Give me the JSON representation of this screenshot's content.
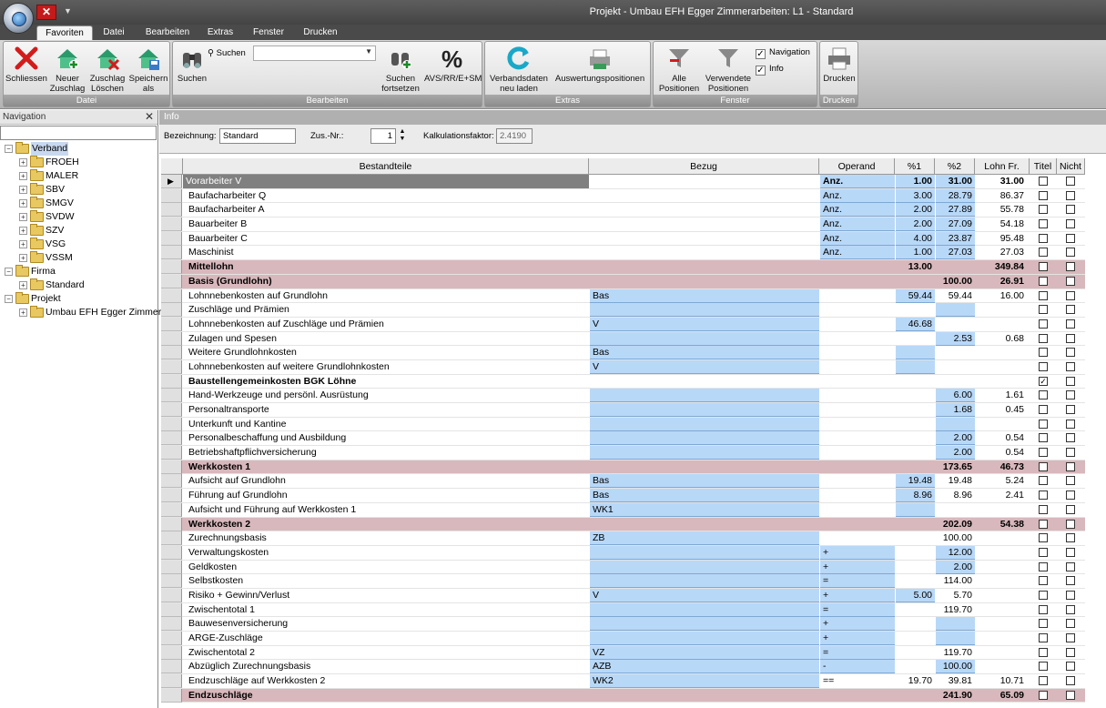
{
  "window": {
    "title": "Projekt - Umbau EFH Egger Zimmerarbeiten: L1 - Standard"
  },
  "qat": {
    "close_glyph": "✕",
    "dropdown_glyph": "▼"
  },
  "tabs": [
    {
      "label": "Favoriten",
      "active": true
    },
    {
      "label": "Datei"
    },
    {
      "label": "Bearbeiten"
    },
    {
      "label": "Extras"
    },
    {
      "label": "Fenster"
    },
    {
      "label": "Drucken"
    }
  ],
  "ribbon": {
    "datei": {
      "label": "Datei",
      "schliessen": "Schliessen",
      "neuer_zuschlag_1": "Neuer",
      "neuer_zuschlag_2": "Zuschlag",
      "zuschlag_loeschen_1": "Zuschlag",
      "zuschlag_loeschen_2": "Löschen",
      "speichern_als_1": "Speichern",
      "speichern_als_2": "als"
    },
    "bearbeiten": {
      "label": "Bearbeiten",
      "suchen": "Suchen",
      "suchen_label": "Suchen",
      "suchen_fortsetzen_1": "Suchen",
      "suchen_fortsetzen_2": "fortsetzen",
      "avs": "AVS/RR/E+SM"
    },
    "extras": {
      "label": "Extras",
      "verbandsdaten_1": "Verbandsdaten",
      "verbandsdaten_2": "neu laden",
      "auswertungspositionen": "Auswertungspositionen"
    },
    "fenster": {
      "label": "Fenster",
      "alle_1": "Alle",
      "alle_2": "Positionen",
      "verwendete_1": "Verwendete",
      "verwendete_2": "Positionen",
      "navigation": "Navigation",
      "info": "Info",
      "checkmark": "✓"
    },
    "drucken": {
      "label": "Drucken",
      "drucken": "Drucken"
    }
  },
  "navigation": {
    "title": "Navigation",
    "close": "✕",
    "expanded_glyph": "−",
    "collapsed_glyph": "+",
    "tree": [
      {
        "label": "Verband",
        "level": 0,
        "expanded": true,
        "selected": true
      },
      {
        "label": "FROEH",
        "level": 1
      },
      {
        "label": "MALER",
        "level": 1
      },
      {
        "label": "SBV",
        "level": 1
      },
      {
        "label": "SMGV",
        "level": 1
      },
      {
        "label": "SVDW",
        "level": 1
      },
      {
        "label": "SZV",
        "level": 1
      },
      {
        "label": "VSG",
        "level": 1
      },
      {
        "label": "VSSM",
        "level": 1
      },
      {
        "label": "Firma",
        "level": 0,
        "expanded": true
      },
      {
        "label": "Standard",
        "level": 1
      },
      {
        "label": "Projekt",
        "level": 0,
        "expanded": true
      },
      {
        "label": "Umbau EFH Egger Zimmerar",
        "level": 1
      }
    ]
  },
  "info": {
    "bar_label": "Info",
    "bezeichnung_label": "Bezeichnung:",
    "bezeichnung_value": "Standard",
    "zus_nr_label": "Zus.-Nr.:",
    "zus_nr_value": "1",
    "kalk_label": "Kalkulationsfaktor:",
    "kalk_value": "2.4190"
  },
  "grid": {
    "row_marker": "▶",
    "check_glyph": "✓",
    "columns": {
      "bestandteile": "Bestandteile",
      "bezug": "Bezug",
      "operand": "Operand",
      "p1": "%1",
      "p2": "%2",
      "lohn": "Lohn Fr.",
      "titel": "Titel",
      "nicht": "Nicht"
    },
    "rows": [
      {
        "name": "Vorarbeiter V",
        "name_dark": true,
        "bezug": "",
        "op": "Anz.",
        "op_blue": true,
        "op_bold": true,
        "p1": "1.00",
        "p1_blue": true,
        "p1_bold": true,
        "p2": "31.00",
        "p2_blue": true,
        "p2_bold": true,
        "lohn": "31.00",
        "lohn_bold": true,
        "titel": false,
        "current": true
      },
      {
        "name": "Baufacharbeiter Q",
        "op": "Anz.",
        "op_blue": true,
        "p1": "3.00",
        "p1_blue": true,
        "p2": "28.79",
        "p2_blue": true,
        "lohn": "86.37"
      },
      {
        "name": "Baufacharbeiter A",
        "op": "Anz.",
        "op_blue": true,
        "p1": "2.00",
        "p1_blue": true,
        "p2": "27.89",
        "p2_blue": true,
        "lohn": "55.78"
      },
      {
        "name": "Bauarbeiter B",
        "op": "Anz.",
        "op_blue": true,
        "p1": "2.00",
        "p1_blue": true,
        "p2": "27.09",
        "p2_blue": true,
        "lohn": "54.18"
      },
      {
        "name": "Bauarbeiter C",
        "op": "Anz.",
        "op_blue": true,
        "p1": "4.00",
        "p1_blue": true,
        "p2": "23.87",
        "p2_blue": true,
        "lohn": "95.48"
      },
      {
        "name": "Maschinist",
        "op": "Anz.",
        "op_blue": true,
        "p1": "1.00",
        "p1_blue": true,
        "p2": "27.03",
        "p2_blue": true,
        "lohn": "27.03"
      },
      {
        "name": "Mittellohn",
        "hl": true,
        "bold": true,
        "p1": "13.00",
        "lohn": "349.84"
      },
      {
        "name": "Basis (Grundlohn)",
        "hl": true,
        "bold": true,
        "p2": "100.00",
        "lohn": "26.91"
      },
      {
        "name": "Lohnnebenkosten auf Grundlohn",
        "bezug": "Bas",
        "bezug_blue": true,
        "p1": "59.44",
        "p1_blue": true,
        "p2": "59.44",
        "lohn": "16.00"
      },
      {
        "name": "Zuschläge und Prämien",
        "bezug": "",
        "bezug_blue": true,
        "p2": "",
        "p2_blue": true
      },
      {
        "name": "Lohnnebenkosten auf Zuschläge und Prämien",
        "bezug": "V",
        "bezug_blue": true,
        "p1": "46.68",
        "p1_blue": true
      },
      {
        "name": "Zulagen und Spesen",
        "bezug": "",
        "bezug_blue": true,
        "p2": "2.53",
        "p2_blue": true,
        "lohn": "0.68"
      },
      {
        "name": "Weitere Grundlohnkosten",
        "bezug": "Bas",
        "bezug_blue": true,
        "p1": "",
        "p1_blue": true
      },
      {
        "name": "Lohnnebenkosten auf weitere Grundlohnkosten",
        "bezug": "V",
        "bezug_blue": true,
        "p1": "",
        "p1_blue": true
      },
      {
        "name": "Baustellengemeinkosten BGK Löhne",
        "bold": true,
        "titel": true
      },
      {
        "name": "Hand-Werkzeuge und persönl. Ausrüstung",
        "bezug": "",
        "bezug_blue": true,
        "p2": "6.00",
        "p2_blue": true,
        "lohn": "1.61"
      },
      {
        "name": "Personaltransporte",
        "bezug": "",
        "bezug_blue": true,
        "p2": "1.68",
        "p2_blue": true,
        "lohn": "0.45"
      },
      {
        "name": "Unterkunft und Kantine",
        "bezug": "",
        "bezug_blue": true,
        "p2": "",
        "p2_blue": true
      },
      {
        "name": "Personalbeschaffung und Ausbildung",
        "bezug": "",
        "bezug_blue": true,
        "p2": "2.00",
        "p2_blue": true,
        "lohn": "0.54"
      },
      {
        "name": "Betriebshaftpflichversicherung",
        "bezug": "",
        "bezug_blue": true,
        "p2": "2.00",
        "p2_blue": true,
        "lohn": "0.54"
      },
      {
        "name": "Werkkosten 1",
        "hl": true,
        "bold": true,
        "p2": "173.65",
        "lohn": "46.73"
      },
      {
        "name": "Aufsicht auf Grundlohn",
        "bezug": "Bas",
        "bezug_blue": true,
        "p1": "19.48",
        "p1_blue": true,
        "p2": "19.48",
        "lohn": "5.24"
      },
      {
        "name": "Führung auf Grundlohn",
        "bezug": "Bas",
        "bezug_blue": true,
        "p1": "8.96",
        "p1_blue": true,
        "p2": "8.96",
        "lohn": "2.41"
      },
      {
        "name": "Aufsicht und Führung auf Werkkosten 1",
        "bezug": "WK1",
        "bezug_blue": true,
        "p1": "",
        "p1_blue": true
      },
      {
        "name": "Werkkosten 2",
        "hl": true,
        "bold": true,
        "p2": "202.09",
        "lohn": "54.38"
      },
      {
        "name": "Zurechnungsbasis",
        "bezug": "ZB",
        "bezug_blue": true,
        "p2": "100.00"
      },
      {
        "name": "Verwaltungskosten",
        "bezug": "",
        "bezug_blue": true,
        "op": "+",
        "op_blue": true,
        "p2": "12.00",
        "p2_blue": true
      },
      {
        "name": "Geldkosten",
        "bezug": "",
        "bezug_blue": true,
        "op": "+",
        "op_blue": true,
        "p2": "2.00",
        "p2_blue": true
      },
      {
        "name": "Selbstkosten",
        "bezug": "",
        "bezug_blue": true,
        "op": "=",
        "op_blue": true,
        "p2": "114.00"
      },
      {
        "name": "Risiko + Gewinn/Verlust",
        "bezug": "V",
        "bezug_blue": true,
        "op": "+",
        "op_blue": true,
        "p1": "5.00",
        "p1_blue": true,
        "p2": "5.70"
      },
      {
        "name": "Zwischentotal 1",
        "bezug": "",
        "bezug_blue": true,
        "op": "=",
        "op_blue": true,
        "p2": "119.70"
      },
      {
        "name": "Bauwesenversicherung",
        "bezug": "",
        "bezug_blue": true,
        "op": "+",
        "op_blue": true,
        "p2": "",
        "p2_blue": true
      },
      {
        "name": "ARGE-Zuschläge",
        "bezug": "",
        "bezug_blue": true,
        "op": "+",
        "op_blue": true,
        "p2": "",
        "p2_blue": true
      },
      {
        "name": "Zwischentotal 2",
        "bezug": "VZ",
        "bezug_blue": true,
        "op": "=",
        "op_blue": true,
        "p2": "119.70"
      },
      {
        "name": "Abzüglich Zurechnungsbasis",
        "bezug": "AZB",
        "bezug_blue": true,
        "op": "-",
        "op_blue": true,
        "p2": "100.00",
        "p2_blue": true
      },
      {
        "name": "Endzuschläge auf Werkkosten 2",
        "bezug": "WK2",
        "bezug_blue": true,
        "op": "==",
        "p1": "19.70",
        "p2": "39.81",
        "lohn": "10.71"
      },
      {
        "name": "Endzuschläge",
        "hl": true,
        "bold": true,
        "p2": "241.90",
        "lohn": "65.09"
      }
    ]
  }
}
